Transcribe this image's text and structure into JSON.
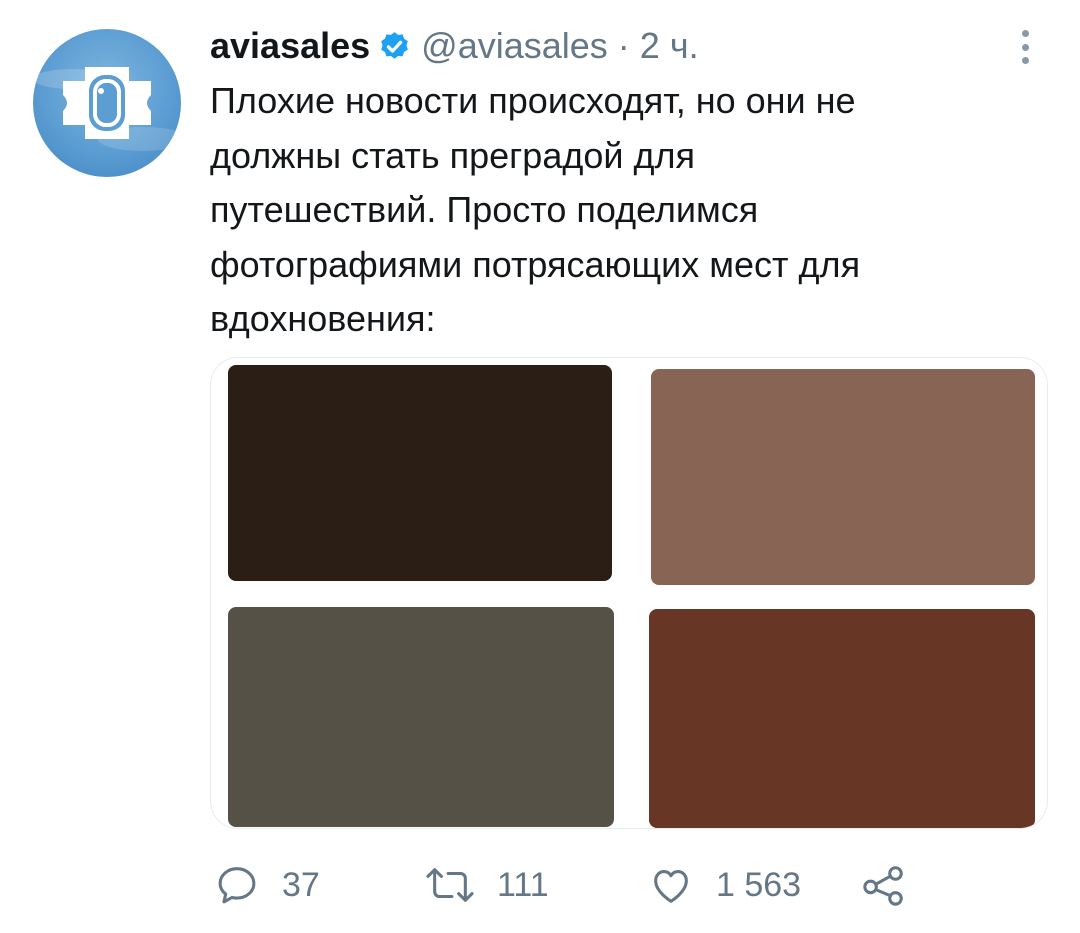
{
  "tweet": {
    "display_name": "aviasales",
    "handle": "@aviasales",
    "separator": "·",
    "time": "2 ч.",
    "text": "Плохие новости происходят, но они не\nдолжны стать преградой для\nпутешествий. Просто поделимся\nфотографиями потрясающих мест для\nвдохновения:",
    "avatar_icon": "airplane-window-logo-icon",
    "verified_icon": "verified-badge-icon",
    "more_icon": "more-vertical-icon"
  },
  "media": {
    "photos": [
      {
        "name": "photo-1",
        "color": "#2b1f15"
      },
      {
        "name": "photo-2",
        "color": "#876454"
      },
      {
        "name": "photo-3",
        "color": "#565146"
      },
      {
        "name": "photo-4",
        "color": "#673624"
      }
    ]
  },
  "actions": {
    "reply": {
      "icon": "reply-icon",
      "count": "37"
    },
    "retweet": {
      "icon": "retweet-icon",
      "count": "111"
    },
    "like": {
      "icon": "heart-icon",
      "count": "1 563"
    },
    "share": {
      "icon": "share-icon"
    }
  },
  "colors": {
    "accent": "#1da1f2",
    "secondary_text": "#657786",
    "primary_text": "#14171a"
  }
}
